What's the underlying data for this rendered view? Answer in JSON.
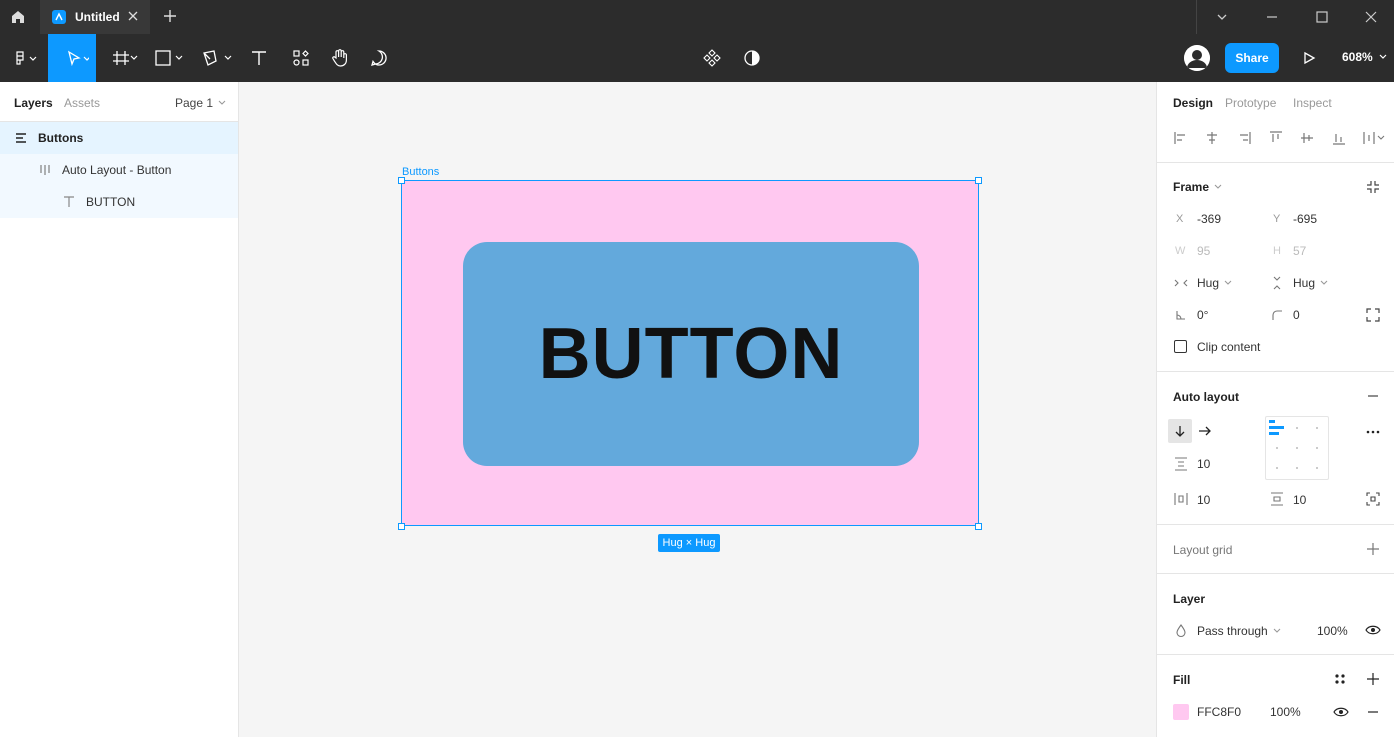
{
  "titlebar": {
    "tab_title": "Untitled"
  },
  "toolbar": {
    "share_label": "Share",
    "zoom_level": "608%"
  },
  "left_panel": {
    "tabs": [
      "Layers",
      "Assets"
    ],
    "page_selector": "Page 1",
    "layers": [
      {
        "label": "Buttons",
        "type": "frame"
      },
      {
        "label": "Auto Layout - Button",
        "type": "auto-layout"
      },
      {
        "label": "BUTTON",
        "type": "text"
      }
    ]
  },
  "canvas": {
    "frame_label": "Buttons",
    "button_text": "BUTTON",
    "size_badge": "Hug × Hug",
    "frame_fill": "#FFC8F0",
    "button_fill": "#63A9DC",
    "selection_color": "#0D99FF"
  },
  "right_panel": {
    "tabs": [
      "Design",
      "Prototype",
      "Inspect"
    ],
    "frame": {
      "title": "Frame",
      "x_label": "X",
      "x": "-369",
      "y_label": "Y",
      "y": "-695",
      "w_label": "W",
      "w": "95",
      "h_label": "H",
      "h": "57",
      "h_sizing": "Hug",
      "v_sizing": "Hug",
      "rotation": "0°",
      "radius": "0",
      "clip_content": "Clip content"
    },
    "auto_layout": {
      "title": "Auto layout",
      "gap": "10",
      "padding_h": "10",
      "padding_v": "10"
    },
    "layout_grid": {
      "title": "Layout grid"
    },
    "layer": {
      "title": "Layer",
      "blend_mode": "Pass through",
      "opacity": "100%"
    },
    "fill": {
      "title": "Fill",
      "hex": "FFC8F0",
      "opacity": "100%"
    }
  }
}
